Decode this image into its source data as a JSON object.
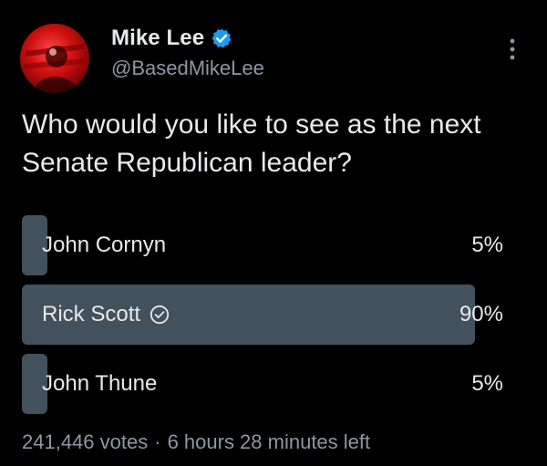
{
  "author": {
    "display_name": "Mike Lee",
    "handle": "@BasedMikeLee",
    "avatar_icon": "avatar-image",
    "verified_icon": "verified-badge-icon",
    "verified_color": "#1d9bf0"
  },
  "tweet": {
    "text": "Who would you like to see as the next Senate Republican leader?"
  },
  "poll": {
    "options": [
      {
        "label": "John Cornyn",
        "percent_label": "5%",
        "share": 0.05,
        "selected": false
      },
      {
        "label": "Rick Scott",
        "percent_label": "90%",
        "share": 0.9,
        "selected": true
      },
      {
        "label": "John Thune",
        "percent_label": "5%",
        "share": 0.05,
        "selected": false
      }
    ],
    "votes": "241,446 votes",
    "separator": "·",
    "time_left": "6 hours 28 minutes left",
    "bar_color": "#43515c"
  },
  "colors": {
    "background": "#000000",
    "text_primary": "#e7e9ea",
    "text_secondary": "#8b98a5"
  }
}
